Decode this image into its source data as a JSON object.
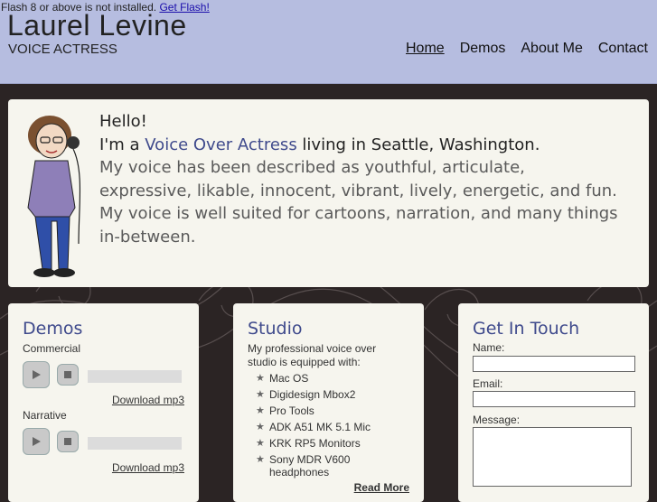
{
  "header": {
    "flash_notice": "Flash 8 or above is not installed.",
    "flash_link": "Get Flash!",
    "site_title": "Laurel Levine",
    "site_subtitle": "VOICE ACTRESS",
    "nav": [
      "Home",
      "Demos",
      "About Me",
      "Contact"
    ],
    "active_nav": "Home"
  },
  "hero": {
    "greeting": "Hello!",
    "line2_prefix": "I'm a ",
    "line2_link": "Voice Over Actress",
    "line2_suffix": " living in Seattle, Washington.",
    "description": "My voice has been described as youthful, articulate, expressive, likable, innocent, vibrant, lively, energetic, and fun. My voice is well suited for cartoons, narration, and many things in-between."
  },
  "demos": {
    "title": "Demos",
    "items": [
      {
        "label": "Commercial",
        "download": "Download mp3"
      },
      {
        "label": "Narrative",
        "download": "Download mp3"
      }
    ]
  },
  "studio": {
    "title": "Studio",
    "intro": "My professional voice over studio is equipped with:",
    "items": [
      "Mac OS",
      "Digidesign Mbox2",
      "Pro Tools",
      "ADK A51 MK 5.1 Mic",
      "KRK RP5 Monitors",
      "Sony MDR V600 headphones"
    ],
    "read_more": "Read More"
  },
  "contact": {
    "title": "Get In Touch",
    "name_label": "Name:",
    "email_label": "Email:",
    "message_label": "Message:"
  },
  "colors": {
    "header_bg": "#b6bde0",
    "accent": "#3f4a8c",
    "page_bg": "#2b2424",
    "card_bg": "#f6f5ee"
  }
}
